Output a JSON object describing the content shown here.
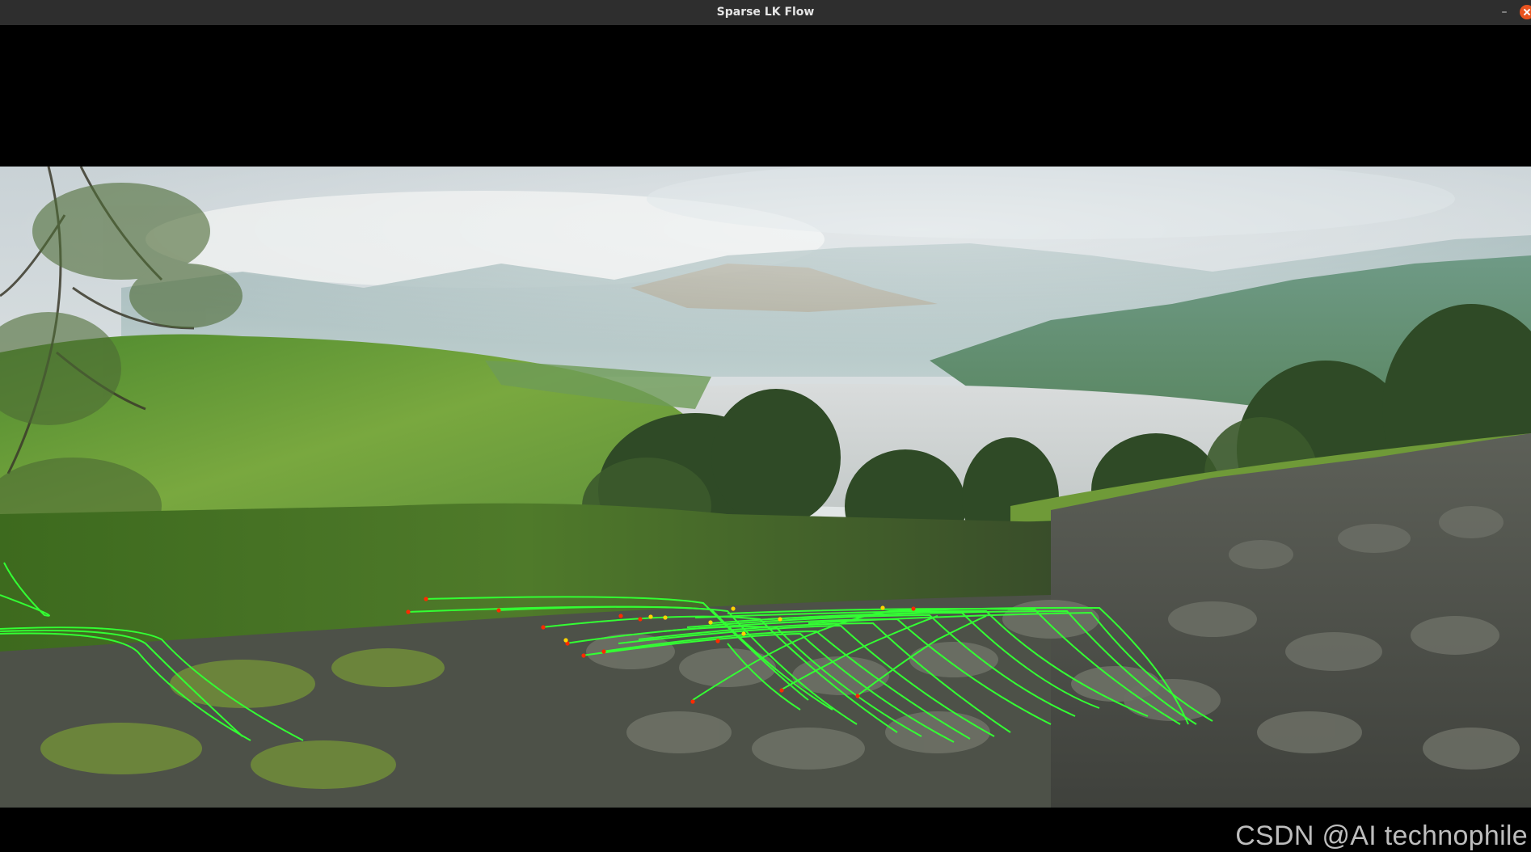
{
  "window": {
    "title": "Sparse LK Flow",
    "minimize_glyph": "–"
  },
  "video_frame": {
    "scene": "lake-valley-with-stone-wall",
    "overlay": {
      "track_color": "#33ff33",
      "point_color": "#ff2a00",
      "highlight_color": "#ffd400"
    }
  },
  "watermark": {
    "text": "CSDN @AI technophile"
  }
}
